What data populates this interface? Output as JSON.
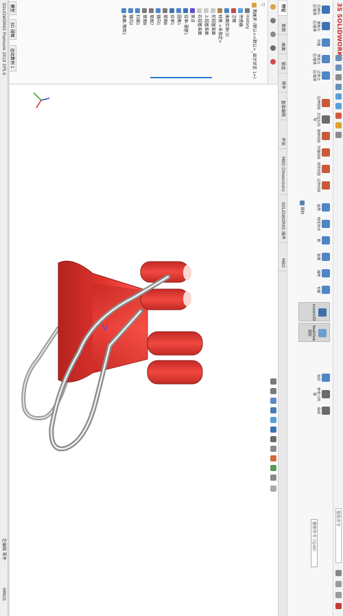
{
  "app": {
    "logo_text": "3S SOLIDWORKS",
    "search_placeholder": "搜索命令",
    "help": "?"
  },
  "ribbon": {
    "buttons": [
      {
        "label": "拉伸凸台/基体",
        "color": "#3d73b5"
      },
      {
        "label": "旋转凸台/基体",
        "color": "#3d73b5"
      },
      {
        "label": "扫描",
        "color": "#4f86c6"
      },
      {
        "label": "放样凸台/基体",
        "color": "#4f86c6"
      },
      {
        "label": "边界凸台/基体",
        "color": "#4f86c6"
      },
      {
        "label": "拉伸切除",
        "color": "#c85a3a"
      },
      {
        "label": "异型孔向导",
        "color": "#6b6b6b"
      },
      {
        "label": "旋转切除",
        "color": "#c85a3a"
      },
      {
        "label": "扫描切除",
        "color": "#c85a3a"
      },
      {
        "label": "放样切割",
        "color": "#c85a3a"
      },
      {
        "label": "边界切除",
        "color": "#c85a3a"
      },
      {
        "label": "圆角",
        "color": "#4f86c6"
      },
      {
        "label": "线性阵列",
        "color": "#4f86c6"
      },
      {
        "label": "筋",
        "color": "#4f86c6"
      },
      {
        "label": "拔模",
        "color": "#4f86c6"
      },
      {
        "label": "抽壳",
        "color": "#4f86c6"
      },
      {
        "label": "包覆",
        "color": "#4f86c6"
      },
      {
        "label": "相交",
        "color": "#4f86c6"
      },
      {
        "label": "参考几何体",
        "color": "#6b6b6b"
      },
      {
        "label": "曲线",
        "color": "#6b6b6b"
      }
    ],
    "small_items": [
      "镜向",
      "Instant3D"
    ],
    "inspect_buttons": [
      "Instant3D",
      "RealView 图形"
    ],
    "cmd_search": "搜索命令 (SJ48)"
  },
  "tabs": [
    {
      "label": "特征",
      "active": true
    },
    {
      "label": "草图",
      "active": false
    },
    {
      "label": "曲面",
      "active": false
    },
    {
      "label": "钣金",
      "active": false
    },
    {
      "label": "焊件",
      "active": false
    },
    {
      "label": "直接编辑",
      "active": false
    },
    {
      "label": "评估",
      "active": false
    },
    {
      "label": "MBD Dimensions",
      "active": false
    },
    {
      "label": "SOLIDWORKS 插件",
      "active": false
    },
    {
      "label": "MBD",
      "active": false
    }
  ],
  "feature_tree": {
    "filter": "▽",
    "items": [
      {
        "label": "燕尾夹 (默认<<默认>_显示状态 1>)",
        "indent": 0,
        "icon": "part-icon"
      },
      {
        "label": "History",
        "indent": 1,
        "icon": "history-icon"
      },
      {
        "label": "传感器",
        "indent": 1,
        "icon": "sensor-icon"
      },
      {
        "label": "注解",
        "indent": 1,
        "icon": "annotation-icon"
      },
      {
        "label": "曲面实体(3)",
        "indent": 1,
        "icon": "surface-icon"
      },
      {
        "label": "材质 <未指定>",
        "indent": 1,
        "icon": "material-icon"
      },
      {
        "label": "前视基准面",
        "indent": 1,
        "icon": "plane-icon"
      },
      {
        "label": "上视基准面",
        "indent": 1,
        "icon": "plane-icon"
      },
      {
        "label": "右视基准面",
        "indent": 1,
        "icon": "plane-icon"
      },
      {
        "label": "原点",
        "indent": 1,
        "icon": "origin-icon"
      },
      {
        "label": "拉伸-薄壁1",
        "indent": 1,
        "icon": "extrude-icon"
      },
      {
        "label": "圆角1",
        "indent": 1,
        "icon": "fillet-icon"
      },
      {
        "label": "拉伸1",
        "indent": 1,
        "icon": "extrude-icon"
      },
      {
        "label": "草图6",
        "indent": 1,
        "icon": "sketch-icon"
      },
      {
        "label": "镜向1",
        "indent": 1,
        "icon": "mirror-icon"
      },
      {
        "label": "草图7",
        "indent": 1,
        "icon": "sketch-icon"
      },
      {
        "label": "草图8",
        "indent": 1,
        "icon": "sketch-icon"
      },
      {
        "label": "扫描1",
        "indent": 1,
        "icon": "sweep-icon"
      },
      {
        "label": "镜向2",
        "indent": 1,
        "icon": "mirror-icon"
      },
      {
        "label": "曲面-等距1",
        "indent": 1,
        "icon": "surface-icon"
      }
    ]
  },
  "model_tabs": [
    "模型",
    "3D 视图",
    "运动算例 1"
  ],
  "status": {
    "left": "SOLIDWORKS Premium 2019 SP5.0",
    "right": "在编辑 零件",
    "units": "MMGS"
  },
  "colors": {
    "clip_red": "#e0332d",
    "wire_silver": "#c9c9c9",
    "accent_blue": "#2a78d4"
  }
}
